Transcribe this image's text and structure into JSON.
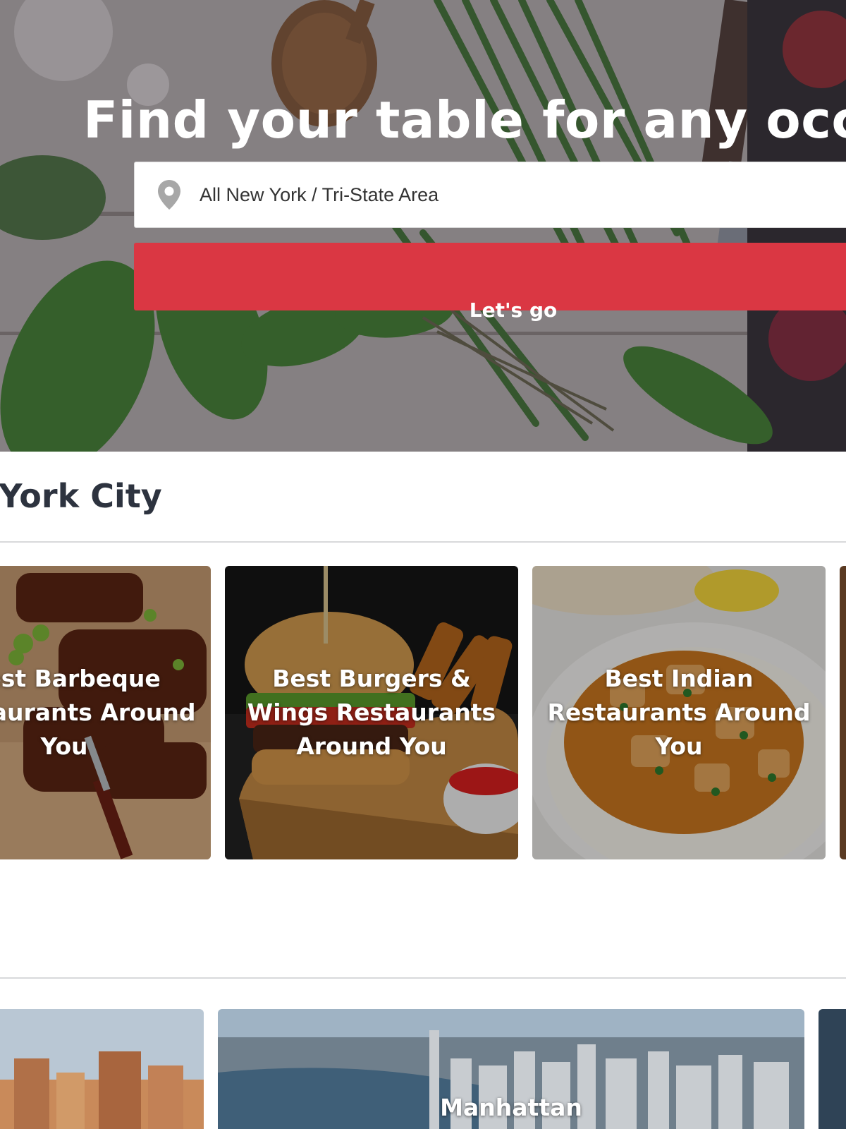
{
  "hero": {
    "title": "Find your table for any occasion",
    "location": {
      "value": "All New York / Tri-State Area",
      "icon": "map-pin-icon"
    },
    "cta_label": "Let's go"
  },
  "section_featured": {
    "title": "New York City",
    "cards": [
      {
        "label": "Best Barbeque Restaurants Around You"
      },
      {
        "label": "Best Burgers & Wings Restaurants Around You"
      },
      {
        "label": "Best Indian Restaurants Around You"
      }
    ]
  },
  "section_neighborhoods": {
    "cards": [
      {
        "label": ""
      },
      {
        "label": "Manhattan"
      },
      {
        "label": ""
      }
    ]
  },
  "colors": {
    "brand_red": "#da3743",
    "heading_text": "#2d333f",
    "divider": "#d8d9db"
  }
}
